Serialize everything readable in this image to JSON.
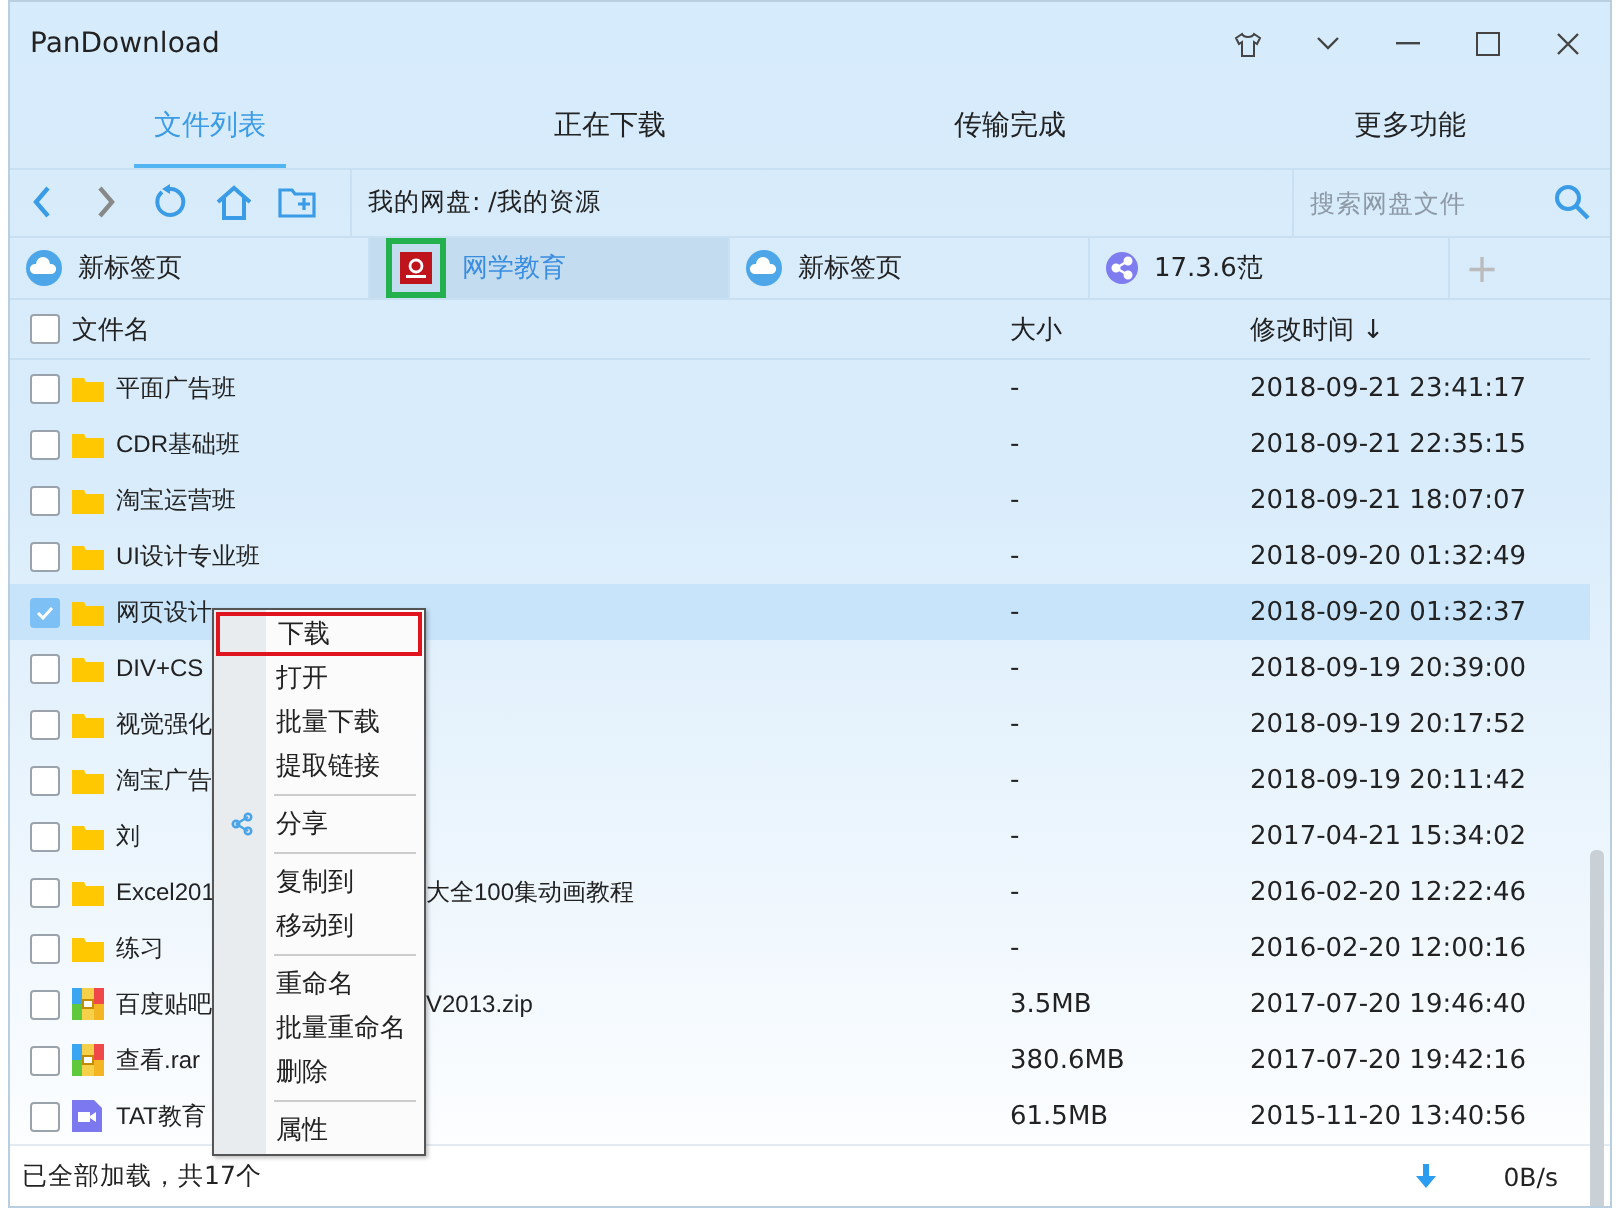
{
  "window": {
    "title": "PanDownload"
  },
  "main_tabs": [
    {
      "label": "文件列表",
      "selected": true
    },
    {
      "label": "正在下载",
      "selected": false
    },
    {
      "label": "传输完成",
      "selected": false
    },
    {
      "label": "更多功能",
      "selected": false
    }
  ],
  "path": "我的网盘: /我的资源",
  "search": {
    "placeholder": "搜索网盘文件"
  },
  "browser_tabs": [
    {
      "label": "新标签页",
      "kind": "cloud",
      "selected": false,
      "outlined": false
    },
    {
      "label": "网学教育",
      "kind": "logo",
      "selected": true,
      "outlined": true
    },
    {
      "label": "新标签页",
      "kind": "cloud",
      "selected": false,
      "outlined": false
    },
    {
      "label": "17.3.6范",
      "kind": "share",
      "selected": false,
      "outlined": false
    }
  ],
  "new_tab": "+",
  "columns": [
    "文件名",
    "大小",
    "修改时间 ↓"
  ],
  "header_checked": false,
  "rows": [
    {
      "kind": "folder",
      "name": "平面广告班",
      "size": "-",
      "modified": "2018-09-21 23:41:17",
      "checked": false
    },
    {
      "kind": "folder",
      "name": "CDR基础班",
      "size": "-",
      "modified": "2018-09-21 22:35:15",
      "checked": false
    },
    {
      "kind": "folder",
      "name": "淘宝运营班",
      "size": "-",
      "modified": "2018-09-21 18:07:07",
      "checked": false
    },
    {
      "kind": "folder",
      "name": "UI设计专业班",
      "size": "-",
      "modified": "2018-09-20 01:32:49",
      "checked": false
    },
    {
      "kind": "folder",
      "name": "网页设计",
      "size": "-",
      "modified": "2018-09-20 01:32:37",
      "checked": true
    },
    {
      "kind": "folder",
      "name": "DIV+CS",
      "size": "-",
      "modified": "2018-09-19 20:39:00",
      "checked": false
    },
    {
      "kind": "folder",
      "name": "视觉强化",
      "size": "-",
      "modified": "2018-09-19 20:17:52",
      "checked": false
    },
    {
      "kind": "folder",
      "name": "淘宝广告",
      "size": "-",
      "modified": "2018-09-19 20:11:42",
      "checked": false
    },
    {
      "kind": "folder",
      "name": "刘",
      "size": "-",
      "modified": "2017-04-21 15:34:02",
      "checked": false
    },
    {
      "kind": "folder",
      "name": "Excel201",
      "name_tail": "大全100集动画教程",
      "size": "-",
      "modified": "2016-02-20 12:22:46",
      "checked": false
    },
    {
      "kind": "folder",
      "name": "练习",
      "size": "-",
      "modified": "2016-02-20 12:00:16",
      "checked": false
    },
    {
      "kind": "archive",
      "name": "百度贴吧",
      "name_tail": "V2013.zip",
      "size": "3.5MB",
      "modified": "2017-07-20 19:46:40",
      "checked": false
    },
    {
      "kind": "archive",
      "name": "查看.rar",
      "size": "380.6MB",
      "modified": "2017-07-20 19:42:16",
      "checked": false
    },
    {
      "kind": "video",
      "name": "TAT教育",
      "size": "61.5MB",
      "modified": "2015-11-20 13:40:56",
      "checked": false
    }
  ],
  "context_menu": [
    [
      {
        "label": "下载",
        "highlighted": true
      },
      {
        "label": "打开",
        "highlighted": false
      },
      {
        "label": "批量下载",
        "highlighted": false
      },
      {
        "label": "提取链接",
        "highlighted": false
      }
    ],
    [
      {
        "label": "分享",
        "highlighted": false,
        "kind": "share"
      }
    ],
    [
      {
        "label": "复制到",
        "highlighted": false
      },
      {
        "label": "移动到",
        "highlighted": false
      }
    ],
    [
      {
        "label": "重命名",
        "highlighted": false
      },
      {
        "label": "批量重命名",
        "highlighted": false
      },
      {
        "label": "删除",
        "highlighted": false
      }
    ],
    [
      {
        "label": "属性",
        "highlighted": false
      }
    ]
  ],
  "status_bar": {
    "text": "已全部加载，共17个",
    "speed": "0B/s"
  }
}
